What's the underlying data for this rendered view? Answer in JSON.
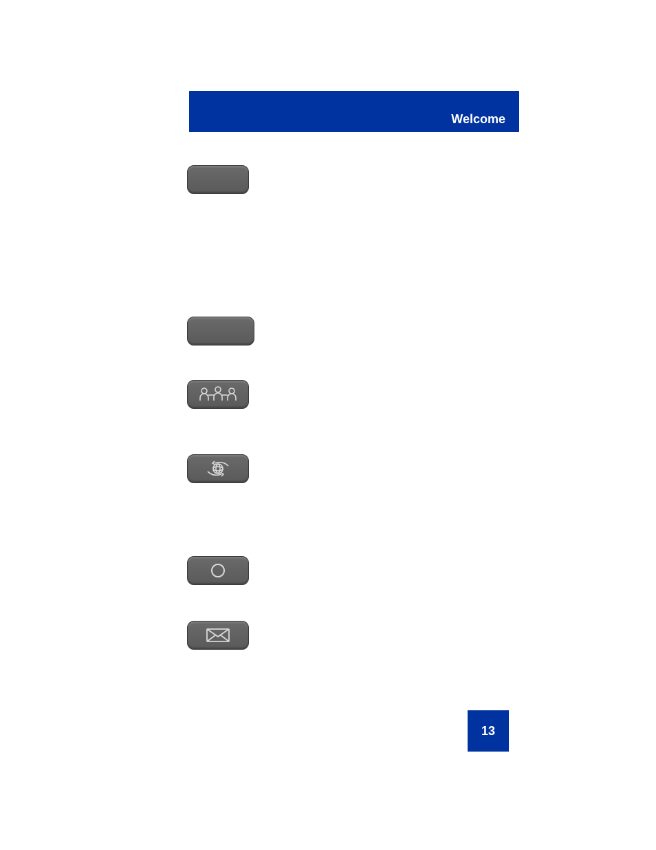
{
  "header": {
    "title": "Welcome"
  },
  "pageNumber": "13",
  "keys": [
    {
      "name": "blank-key-1"
    },
    {
      "name": "blank-key-2"
    },
    {
      "name": "conference-key"
    },
    {
      "name": "internet-key"
    },
    {
      "name": "circle-key"
    },
    {
      "name": "mail-key"
    }
  ]
}
